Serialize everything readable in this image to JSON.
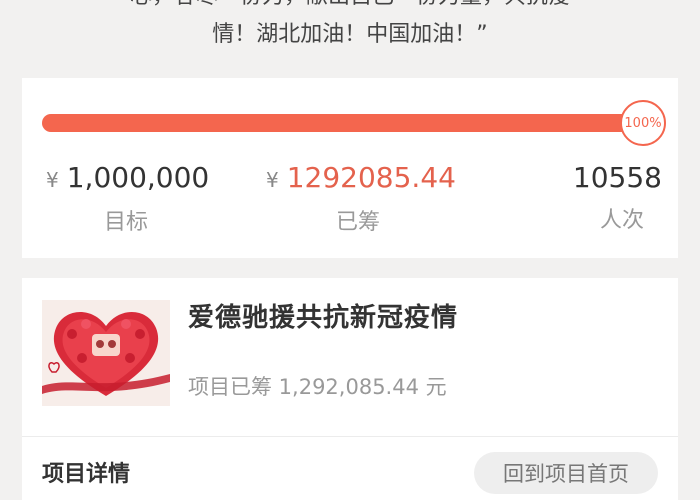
{
  "intro": {
    "line1": "心，容尽一份力，献出自己一份力量，共抗疫",
    "line2": "情！湖北加油！中国加油！”"
  },
  "progress": {
    "percent": 100,
    "badge": "100%",
    "bar_color": "#f4664e"
  },
  "stats": {
    "currency": "¥",
    "target_value": "1,000,000",
    "target_label": "目标",
    "raised_value": "1292085.44",
    "raised_label": "已筹",
    "count_value": "10558",
    "count_label": "人次",
    "accent_color": "#e4624d"
  },
  "project": {
    "thumbnail_icon": "heart-image-icon",
    "title": "爱德驰援共抗新冠疫情",
    "raised_text": "项目已筹 1,292,085.44 元"
  },
  "footer": {
    "details_label": "项目详情",
    "back_button": "回到项目首页"
  }
}
